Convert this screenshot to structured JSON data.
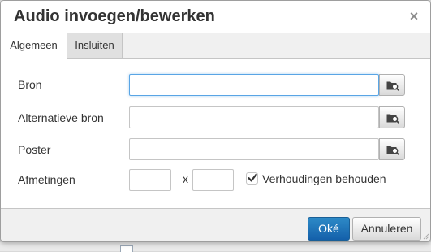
{
  "dialog": {
    "title": "Audio invoegen/bewerken",
    "close_glyph": "×"
  },
  "tabs": [
    {
      "label": "Algemeen",
      "active": true
    },
    {
      "label": "Insluiten",
      "active": false
    }
  ],
  "form": {
    "source_label": "Bron",
    "source_value": "",
    "alt_source_label": "Alternatieve bron",
    "alt_source_value": "",
    "poster_label": "Poster",
    "poster_value": "",
    "dimensions_label": "Afmetingen",
    "width_value": "",
    "height_value": "",
    "dimension_separator": "x",
    "constrain_label": "Verhoudingen behouden",
    "constrain_checked": true
  },
  "icons": {
    "browse": "browse-icon",
    "close": "close-icon",
    "check": "checkmark-icon"
  },
  "footer": {
    "ok_label": "Oké",
    "cancel_label": "Annuleren"
  },
  "colors": {
    "primary_button": "#1f75bb",
    "focus_border": "#59a5e5"
  }
}
